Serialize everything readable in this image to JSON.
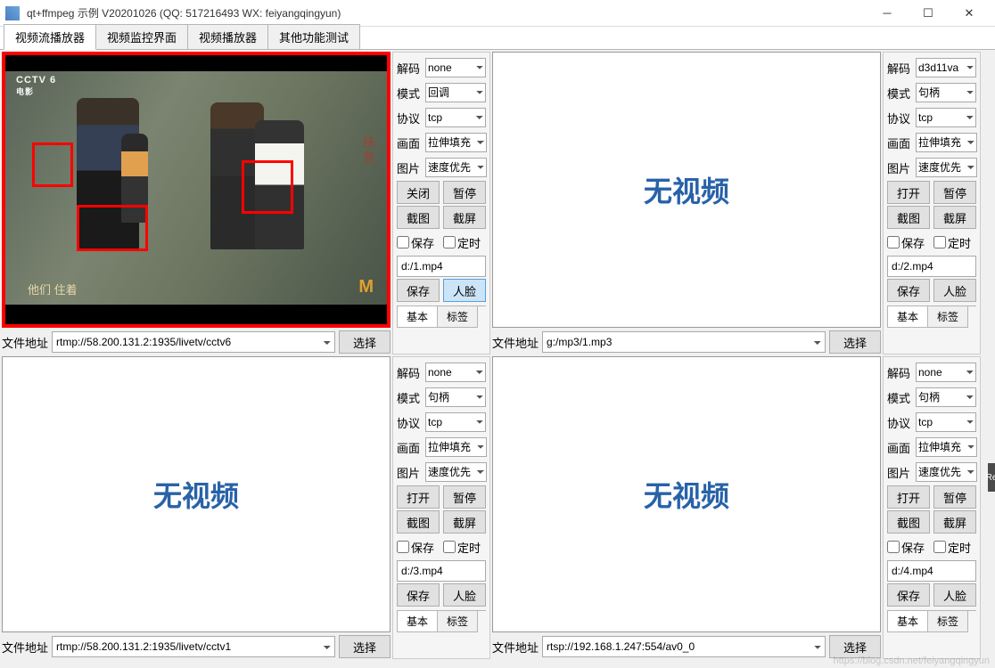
{
  "window": {
    "title": "qt+ffmpeg 示例 V20201026 (QQ: 517216493 WX: feiyangqingyun)"
  },
  "tabs": [
    "视频流播放器",
    "视频监控界面",
    "视频播放器",
    "其他功能测试"
  ],
  "activeTab": 0,
  "addrLabel": "文件地址",
  "selectBtn": "选择",
  "noVideoText": "无视频",
  "ctrlLabels": {
    "decode": "解码",
    "mode": "模式",
    "proto": "协议",
    "scale": "画面",
    "image": "图片",
    "open": "打开",
    "close": "关闭",
    "pause": "暂停",
    "snap": "截图",
    "record": "截屏",
    "save": "保存",
    "timer": "定时",
    "saveBtn": "保存",
    "face": "人脸"
  },
  "subtabs": [
    "基本",
    "标签"
  ],
  "panels": [
    {
      "hasVideo": true,
      "redBorder": true,
      "addr": "rtmp://58.200.131.2:1935/livetv/cctv6",
      "decode": "none",
      "mode": "回调",
      "proto": "tcp",
      "scale": "拉伸填充",
      "image": "速度优先",
      "openBtn": "关闭",
      "file": "d:/1.mp4",
      "faceActive": true
    },
    {
      "hasVideo": false,
      "addr": "g:/mp3/1.mp3",
      "decode": "d3d11va",
      "mode": "句柄",
      "proto": "tcp",
      "scale": "拉伸填充",
      "image": "速度优先",
      "openBtn": "打开",
      "file": "d:/2.mp4",
      "faceActive": false
    },
    {
      "hasVideo": false,
      "addr": "rtmp://58.200.131.2:1935/livetv/cctv1",
      "decode": "none",
      "mode": "句柄",
      "proto": "tcp",
      "scale": "拉伸填充",
      "image": "速度优先",
      "openBtn": "打开",
      "file": "d:/3.mp4",
      "faceActive": false
    },
    {
      "hasVideo": false,
      "addr": "rtsp://192.168.1.247:554/av0_0",
      "decode": "none",
      "mode": "句柄",
      "proto": "tcp",
      "scale": "拉伸填充",
      "image": "速度优先",
      "openBtn": "打开",
      "file": "d:/4.mp4",
      "faceActive": false
    }
  ],
  "videoOverlay": {
    "channelLogo": "CCTV 6",
    "channelSub": "电影",
    "subtitle": "他们  住着",
    "rightLabel": "扶  贫",
    "cornerLogo": "M"
  },
  "watermark": "https://blog.csdn.net/feiyangqingyun",
  "rightBar": "Re"
}
